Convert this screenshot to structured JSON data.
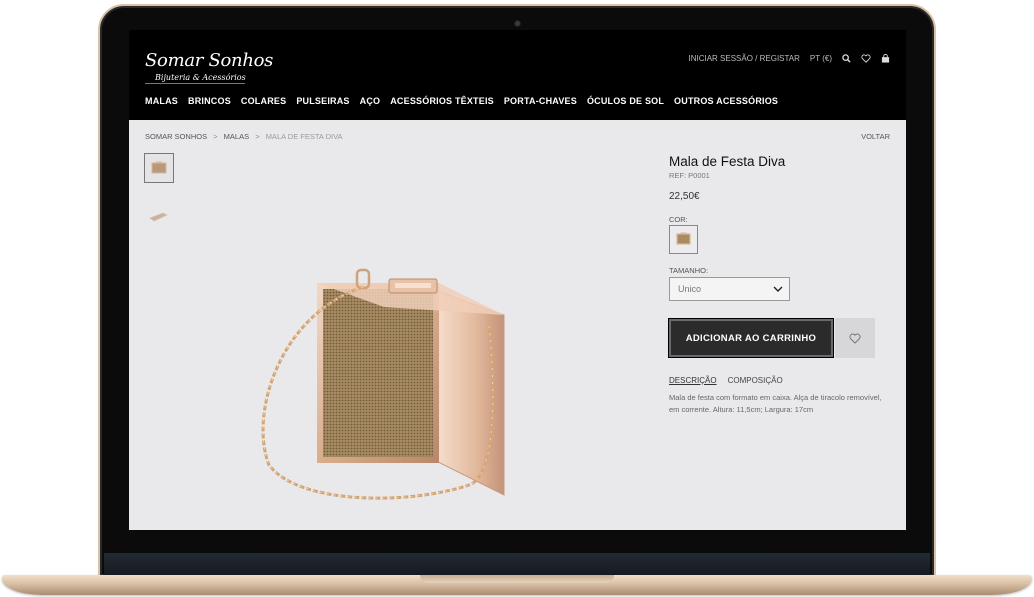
{
  "brand": {
    "name": "Somar Sonhos",
    "tagline": "Bijuteria & Acessórios"
  },
  "header": {
    "login_label": "INICIAR SESSÃO / REGISTAR",
    "locale_label": "PT (€)",
    "icons": [
      "search-icon",
      "heart-icon",
      "bag-icon"
    ]
  },
  "nav": {
    "items": [
      {
        "label": "MALAS"
      },
      {
        "label": "BRINCOS"
      },
      {
        "label": "COLARES"
      },
      {
        "label": "PULSEIRAS"
      },
      {
        "label": "AÇO"
      },
      {
        "label": "ACESSÓRIOS TÊXTEIS"
      },
      {
        "label": "PORTA-CHAVES"
      },
      {
        "label": "ÓCULOS DE SOL"
      },
      {
        "label": "OUTROS ACESSÓRIOS"
      }
    ]
  },
  "breadcrumb": {
    "items": [
      "SOMAR SONHOS",
      "MALAS",
      "MALA DE FESTA DIVA"
    ],
    "separator": ">"
  },
  "back_label": "VOLTAR",
  "product": {
    "title": "Mala de Festa Diva",
    "ref": "REF: P0001",
    "price": "22,50€",
    "color_label": "COR:",
    "size_label": "TAMANHO:",
    "size_value": "Unico",
    "add_to_cart_label": "ADICIONAR AO CARRINHO",
    "tabs": [
      "DESCRIÇÃO",
      "COMPOSIÇÃO"
    ],
    "description": "Mala de festa com formato em caixa. Alça de tiracolo removível, em corrente. Altura: 11,5cm; Largura: 17cm"
  },
  "colors": {
    "header_bg": "#000000",
    "page_bg": "#e9e9eb",
    "button_bg": "#2b2b2b",
    "rose_gold": "#d8b59a"
  }
}
